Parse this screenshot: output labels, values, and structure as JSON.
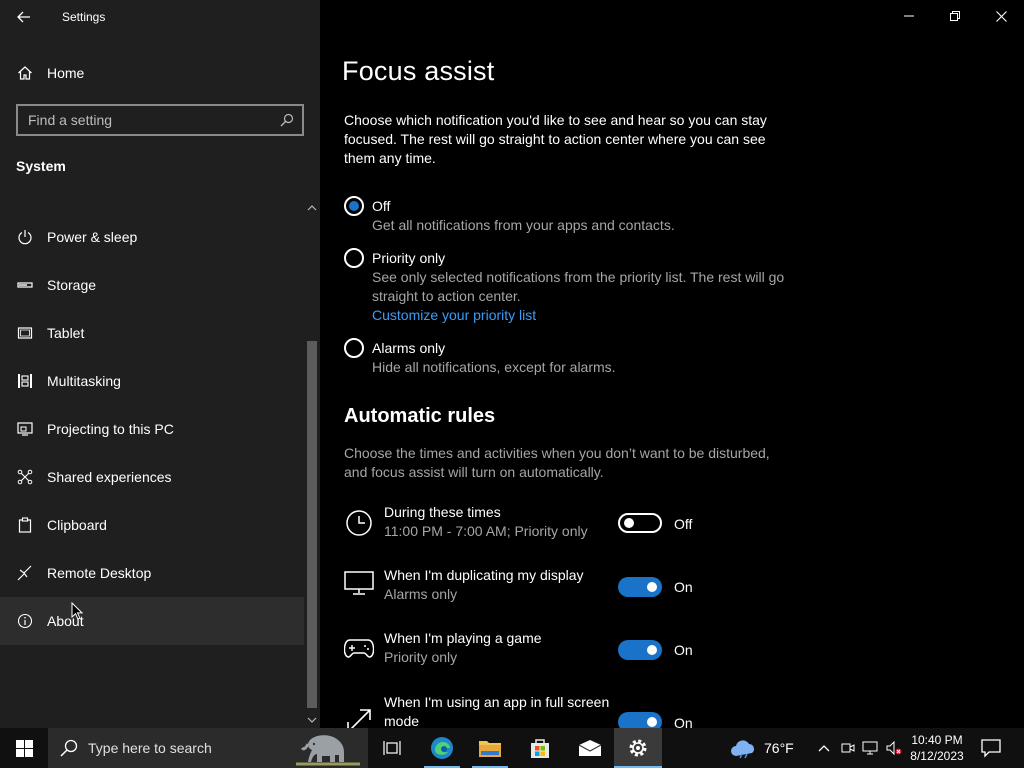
{
  "window": {
    "title": "Settings"
  },
  "sidebar": {
    "home_label": "Home",
    "search_placeholder": "Find a setting",
    "section_title": "System",
    "items": [
      {
        "label": "Power & sleep",
        "icon": "power-icon"
      },
      {
        "label": "Storage",
        "icon": "storage-icon"
      },
      {
        "label": "Tablet",
        "icon": "tablet-icon"
      },
      {
        "label": "Multitasking",
        "icon": "multitasking-icon"
      },
      {
        "label": "Projecting to this PC",
        "icon": "projecting-icon"
      },
      {
        "label": "Shared experiences",
        "icon": "shared-experiences-icon"
      },
      {
        "label": "Clipboard",
        "icon": "clipboard-icon"
      },
      {
        "label": "Remote Desktop",
        "icon": "remote-desktop-icon"
      },
      {
        "label": "About",
        "icon": "info-icon"
      }
    ]
  },
  "main": {
    "title": "Focus assist",
    "intro": "Choose which notification you'd like to see and hear so you can stay focused. The rest will go straight to action center where you can see them any time.",
    "options": [
      {
        "label": "Off",
        "desc": "Get all notifications from your apps and contacts.",
        "selected": true
      },
      {
        "label": "Priority only",
        "desc": "See only selected notifications from the priority list. The rest will go straight to action center.",
        "link": "Customize your priority list",
        "selected": false
      },
      {
        "label": "Alarms only",
        "desc": "Hide all notifications, except for alarms.",
        "selected": false
      }
    ],
    "rules_title": "Automatic rules",
    "rules_desc": "Choose the times and activities when you don’t want to be disturbed, and focus assist will turn on automatically.",
    "rules": [
      {
        "title": "During these times",
        "sub": "11:00 PM - 7:00 AM; Priority only",
        "state": "Off",
        "on": false,
        "icon": "clock-icon"
      },
      {
        "title": "When I'm duplicating my display",
        "sub": "Alarms only",
        "state": "On",
        "on": true,
        "icon": "monitor-icon"
      },
      {
        "title": "When I'm playing a game",
        "sub": "Priority only",
        "state": "On",
        "on": true,
        "icon": "gamepad-icon"
      },
      {
        "title": "When I'm using an app in full screen mode",
        "sub": "",
        "state": "On",
        "on": true,
        "icon": "fullscreen-icon"
      }
    ]
  },
  "taskbar": {
    "search_placeholder": "Type here to search",
    "weather": "76°F",
    "time": "10:40 PM",
    "date": "8/12/2023"
  },
  "colors": {
    "accent": "#1a73c8",
    "link": "#3d9bf5",
    "sidebar_bg": "#1f1f1f"
  }
}
